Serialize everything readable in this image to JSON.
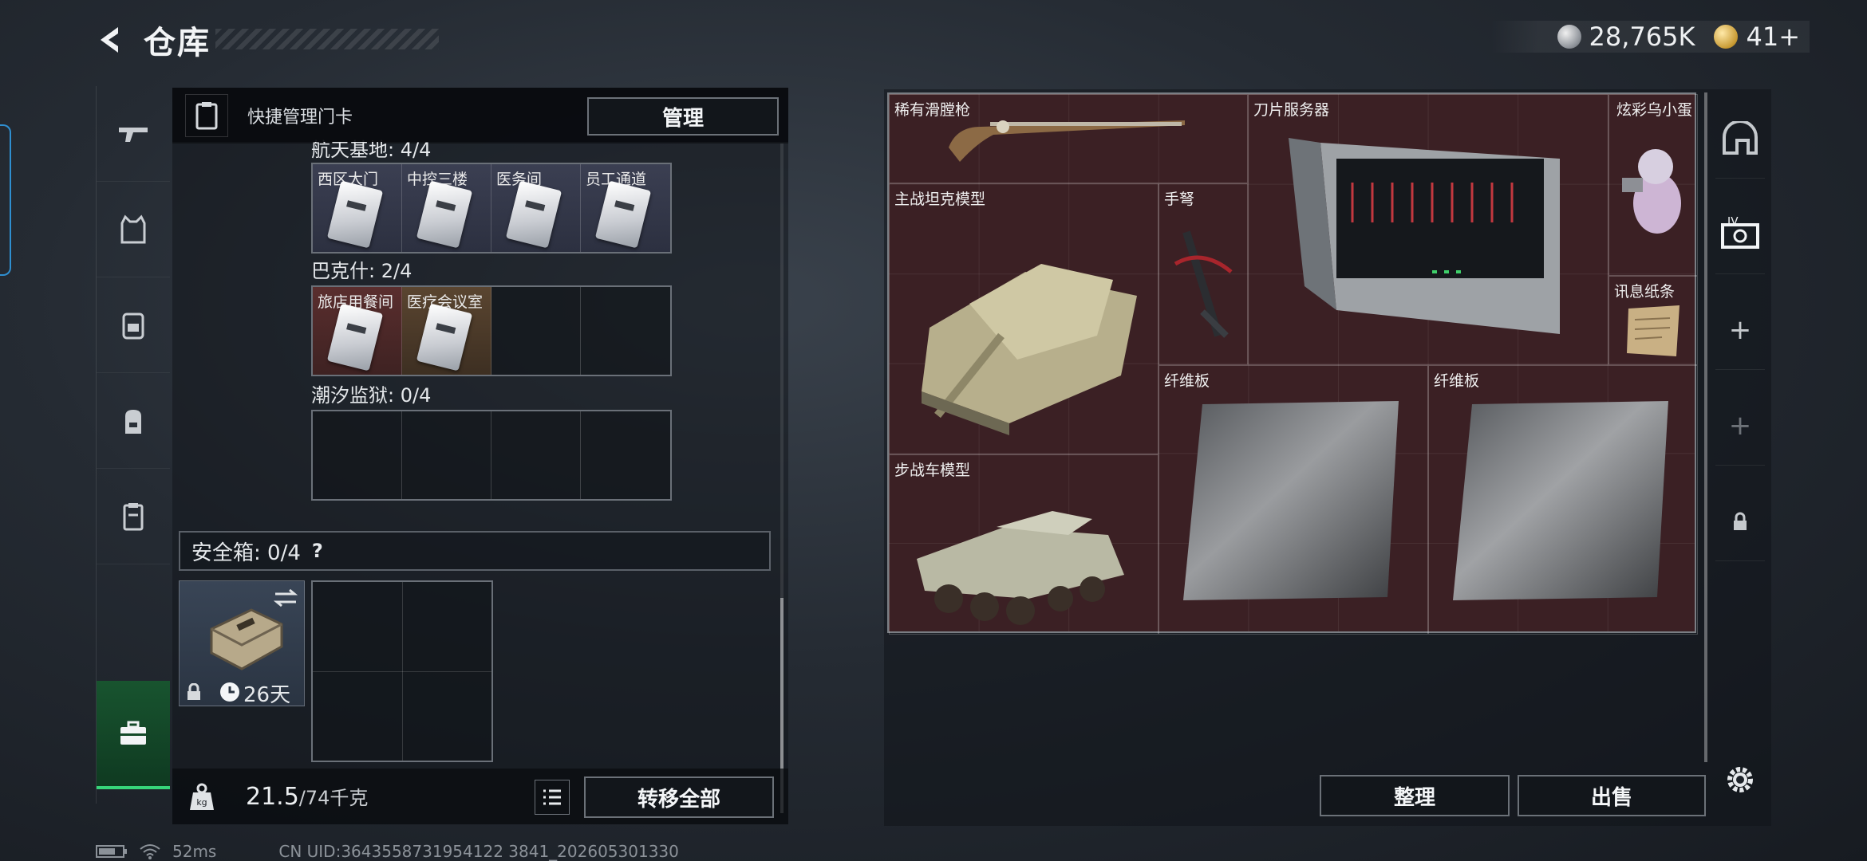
{
  "header": {
    "title": "仓库"
  },
  "currency": [
    {
      "icon": "silver-coin-icon",
      "value": "28,765K"
    },
    {
      "icon": "gold-coin-icon",
      "value": "41+"
    }
  ],
  "left_nav": [
    {
      "name": "weapon",
      "icon": "gun-icon"
    },
    {
      "name": "armor",
      "icon": "vest-icon"
    },
    {
      "name": "chest-rig",
      "icon": "chest-rig-icon"
    },
    {
      "name": "backpack",
      "icon": "backpack-icon"
    },
    {
      "name": "keycard",
      "icon": "keycard-holder-icon"
    },
    {
      "name": "safebox",
      "icon": "briefcase-icon",
      "active": true
    }
  ],
  "keycard_panel": {
    "header_label": "快捷管理门卡",
    "manage_label": "管理",
    "groups": [
      {
        "label": "航天基地: 4/4",
        "slots": [
          "西区大门",
          "中控三楼",
          "医务间",
          "员工通道"
        ]
      },
      {
        "label": "巴克什: 2/4",
        "slots": [
          "旅店用餐间",
          "医疗会议室",
          "",
          ""
        ]
      },
      {
        "label": "潮汐监狱: 0/4",
        "slots": [
          "",
          "",
          "",
          ""
        ]
      }
    ]
  },
  "safebox": {
    "label": "安全箱: 0/4",
    "help": "?",
    "timer": "26天"
  },
  "bottom": {
    "weight_current": "21.5",
    "weight_max": "/74千克",
    "transfer_label": "转移全部"
  },
  "stash": {
    "items": [
      {
        "label": "稀有滑膛枪"
      },
      {
        "label": "刀片服务器"
      },
      {
        "label": "炫彩乌小蛋"
      },
      {
        "label": "主战坦克模型"
      },
      {
        "label": "手弩"
      },
      {
        "label": "讯息纸条"
      },
      {
        "label": "纤维板"
      },
      {
        "label": "纤维板"
      },
      {
        "label": "步战车模型"
      }
    ],
    "sort_label": "整理",
    "sell_label": "出售"
  },
  "status": {
    "ping": "52ms",
    "uid": "CN UID:3643558731954122 3841_202605301330"
  },
  "colors": {
    "stash_bg": "#3b2024",
    "active_nav": "#37d47a",
    "accent_blue": "#2f8fd0"
  }
}
